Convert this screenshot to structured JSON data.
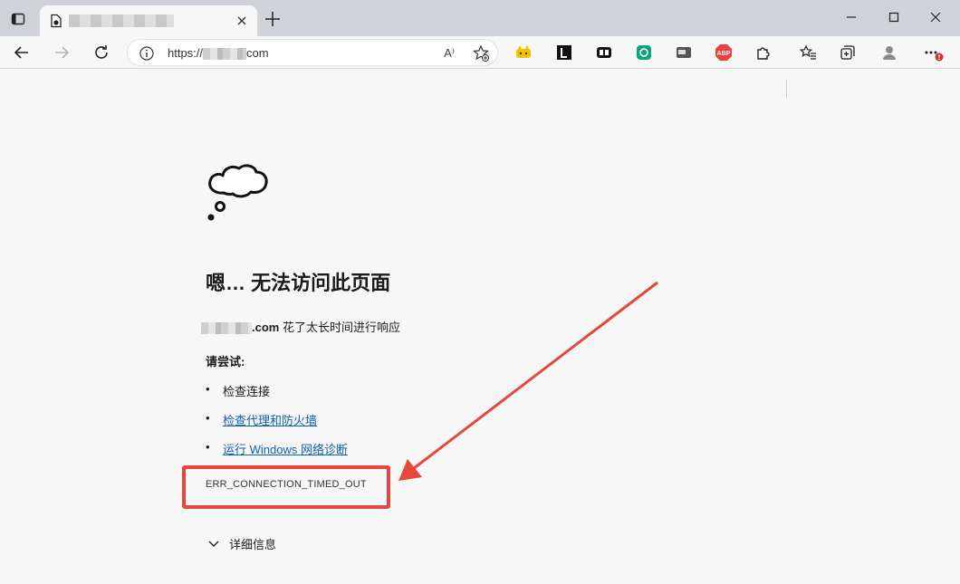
{
  "browser": {
    "tab": {
      "close_label": "×"
    },
    "new_tab_label": "+",
    "address": {
      "url_prefix": "https://",
      "url_suffix": "com"
    },
    "read_aloud_label": "A⁾"
  },
  "error_page": {
    "heading": "嗯… 无法访问此页面",
    "message_host_suffix": ".com",
    "message_text": " 花了太长时间进行响应",
    "try_label": "请尝试:",
    "suggestions": [
      {
        "text": "检查连接",
        "link": false
      },
      {
        "text": "检查代理和防火墙",
        "link": true
      },
      {
        "text": "运行 Windows 网络诊断",
        "link": true
      }
    ],
    "error_code": "ERR_CONNECTION_TIMED_OUT",
    "details_label": "详细信息"
  },
  "colors": {
    "annotation": "#e5473f",
    "link": "#0f5fb3"
  },
  "icons": [
    "tab-actions-icon",
    "page-icon",
    "close-icon",
    "plus-icon",
    "minimize-icon",
    "maximize-icon",
    "window-close-icon",
    "back-icon",
    "forward-icon",
    "refresh-icon",
    "info-icon",
    "favorite-add-icon",
    "extension-icons",
    "favorites-icon",
    "collections-icon",
    "profile-icon",
    "more-icon",
    "cloud-icon",
    "chevron-down-icon"
  ]
}
